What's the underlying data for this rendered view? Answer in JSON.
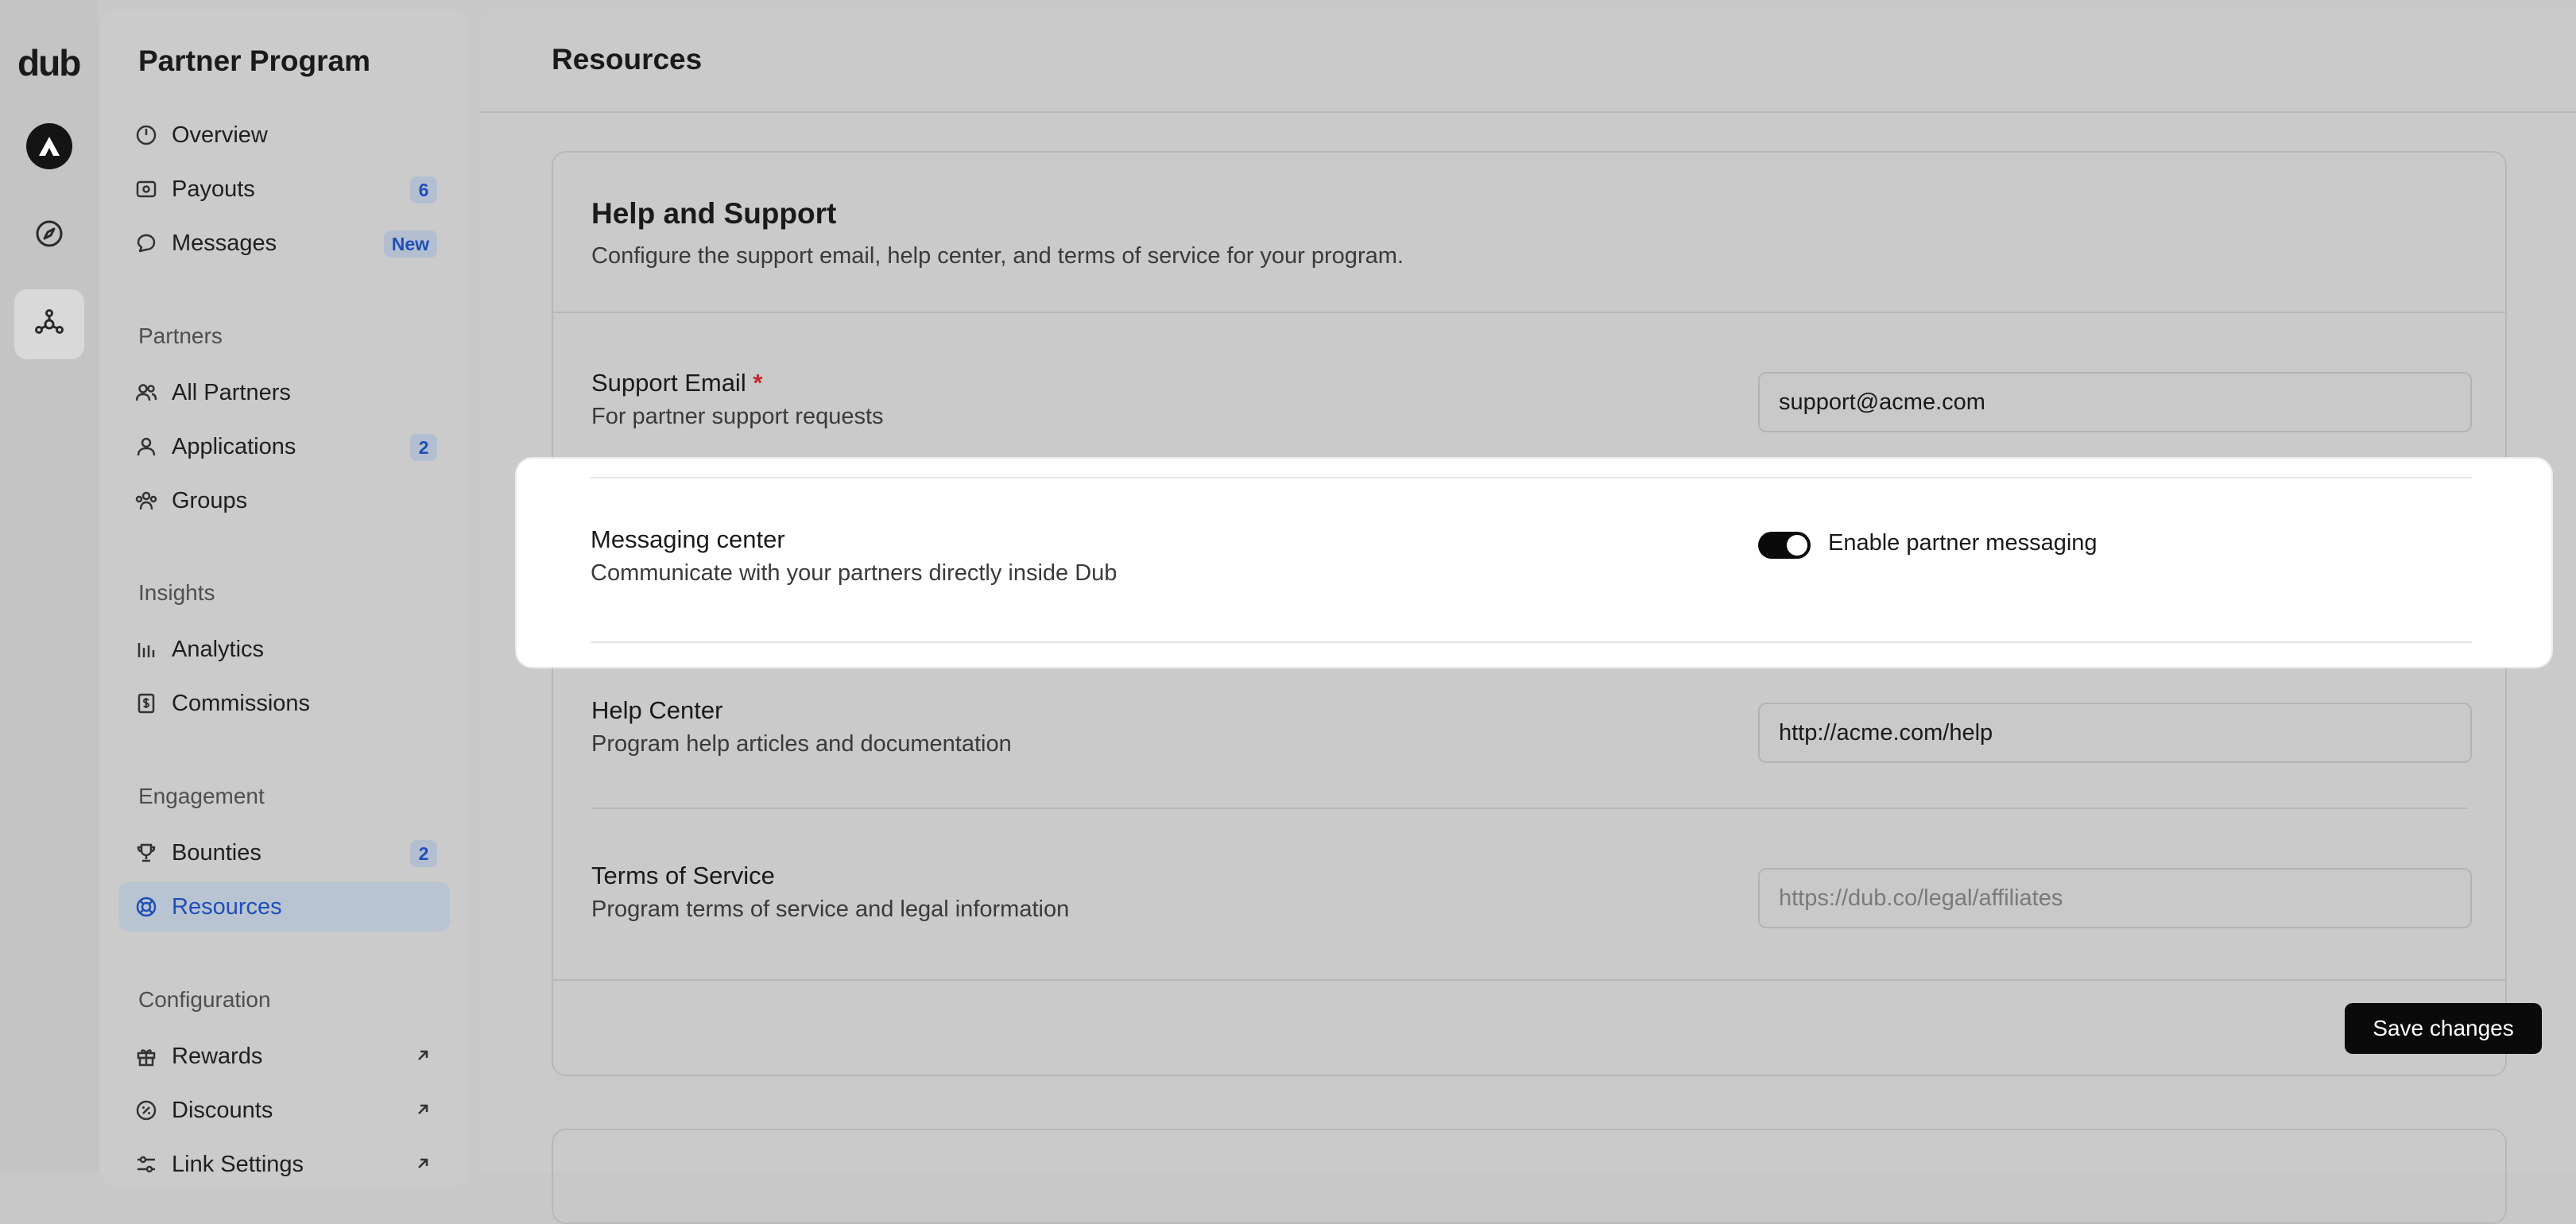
{
  "rail": {
    "logo": "dub",
    "items": [
      {
        "icon": "workspace-avatar-icon"
      },
      {
        "icon": "compass-icon"
      },
      {
        "icon": "partner-network-icon",
        "active": true
      }
    ]
  },
  "sidebar": {
    "title": "Partner Program",
    "groups": [
      {
        "items": [
          {
            "label": "Overview",
            "icon": "gauge-icon"
          },
          {
            "label": "Payouts",
            "icon": "money-icon",
            "badge": "6"
          },
          {
            "label": "Messages",
            "icon": "message-icon",
            "badge": "New"
          }
        ]
      },
      {
        "label": "Partners",
        "items": [
          {
            "label": "All Partners",
            "icon": "users-icon"
          },
          {
            "label": "Applications",
            "icon": "user-icon",
            "badge": "2"
          },
          {
            "label": "Groups",
            "icon": "users-group-icon"
          }
        ]
      },
      {
        "label": "Insights",
        "items": [
          {
            "label": "Analytics",
            "icon": "bar-chart-icon"
          },
          {
            "label": "Commissions",
            "icon": "invoice-dollar-icon"
          }
        ]
      },
      {
        "label": "Engagement",
        "items": [
          {
            "label": "Bounties",
            "icon": "trophy-icon",
            "badge": "2"
          },
          {
            "label": "Resources",
            "icon": "lifebuoy-icon",
            "active": true
          }
        ]
      },
      {
        "label": "Configuration",
        "items": [
          {
            "label": "Rewards",
            "icon": "gift-icon",
            "external": true
          },
          {
            "label": "Discounts",
            "icon": "discount-icon",
            "external": true
          },
          {
            "label": "Link Settings",
            "icon": "sliders-icon",
            "external": true
          }
        ]
      }
    ]
  },
  "main": {
    "page_title": "Resources",
    "card": {
      "title": "Help and Support",
      "description": "Configure the support email, help center, and terms of service for your program.",
      "support_email": {
        "label": "Support Email",
        "required_mark": "*",
        "sub": "For partner support requests",
        "value": "support@acme.com"
      },
      "messaging": {
        "label": "Messaging center",
        "sub": "Communicate with your partners directly inside Dub",
        "toggle_label": "Enable partner messaging",
        "enabled": true
      },
      "help_center": {
        "label": "Help Center",
        "sub": "Program help articles and documentation",
        "value": "http://acme.com/help"
      },
      "terms": {
        "label": "Terms of Service",
        "sub": "Program terms of service and legal information",
        "value": "",
        "placeholder": "https://dub.co/legal/affiliates"
      },
      "save_label": "Save changes"
    }
  },
  "colors": {
    "accent": "#1e4fb8",
    "required": "#c0262d",
    "primary_button": "#0a0a0a"
  }
}
